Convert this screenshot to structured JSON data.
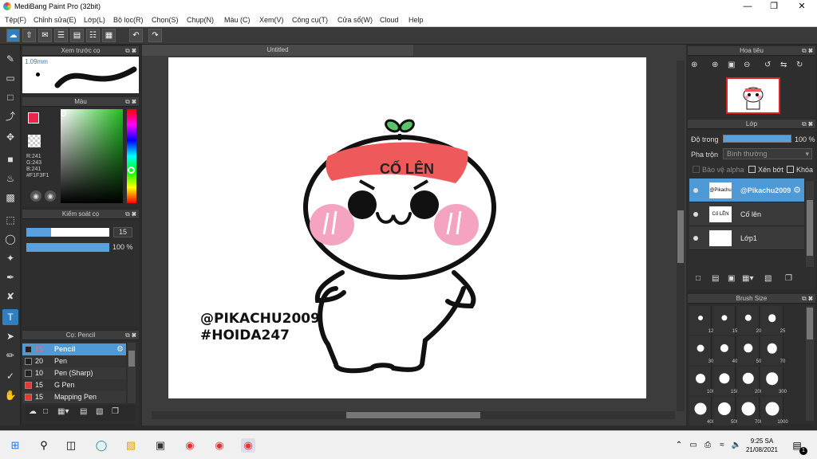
{
  "window": {
    "title": "MediBang Paint Pro (32bit)"
  },
  "menu": [
    "Tệp(F)",
    "Chỉnh sửa(E)",
    "Lớp(L)",
    "Bộ lọc(R)",
    "Chọn(S)",
    "Chụp(N)",
    "Màu (C)",
    "Xem(V)",
    "Công cụ(T)",
    "Cửa sổ(W)",
    "Cloud",
    "Help"
  ],
  "document": {
    "tab": "Untitled"
  },
  "brush_preview": {
    "title": "Xem trước cọ",
    "size": "1.09mm"
  },
  "color_panel": {
    "title": "Màu",
    "r": "R:241",
    "g": "G:243",
    "b": "B:241",
    "hex": "#F1F3F1"
  },
  "brush_control": {
    "title": "Kiểm soát cọ",
    "size": "15",
    "opacity": "100 %",
    "size_fill": 0.3,
    "opacity_fill": 1.0
  },
  "brush_list": {
    "title": "Cọ: Pencil",
    "items": [
      {
        "size": "15",
        "name": "Pencil",
        "color": "#222222",
        "selected": true
      },
      {
        "size": "20",
        "name": "Pen",
        "color": "#222222",
        "selected": false
      },
      {
        "size": "10",
        "name": "Pen (Sharp)",
        "color": "#222222",
        "selected": false
      },
      {
        "size": "15",
        "name": "G Pen",
        "color": "#e53935",
        "selected": false
      },
      {
        "size": "15",
        "name": "Mapping Pen",
        "color": "#e53935",
        "selected": false
      }
    ]
  },
  "navigator": {
    "title": "Hoa tiêu"
  },
  "layer_panel": {
    "title": "Lớp",
    "opacity_label": "Độ trong",
    "opacity_value": "100 %",
    "blend_label": "Pha trộn",
    "blend_value": "Bình thường",
    "protect_alpha": "Bảo vệ alpha",
    "clipping": "Xén bớt",
    "lock": "Khóa",
    "layers": [
      {
        "name": "@Pikachu2009",
        "thumb": "@Pikachu",
        "selected": true
      },
      {
        "name": "Cố lên",
        "thumb": "Cố LÊN",
        "selected": false
      },
      {
        "name": "Lớp1",
        "thumb": "",
        "selected": false
      }
    ]
  },
  "brush_size": {
    "title": "Brush Size",
    "sizes": [
      "12",
      "15",
      "20",
      "25",
      "30",
      "40",
      "50",
      "70",
      "100",
      "150",
      "200",
      "300",
      "400",
      "500",
      "700",
      "1000"
    ]
  },
  "artwork": {
    "headband_text": "CỐ LÊN",
    "line1": "@PIKACHU2009",
    "line2": "#HOIDA247"
  },
  "taskbar": {
    "time": "9:25 SA",
    "date": "21/08/2021",
    "notif_count": "1"
  }
}
